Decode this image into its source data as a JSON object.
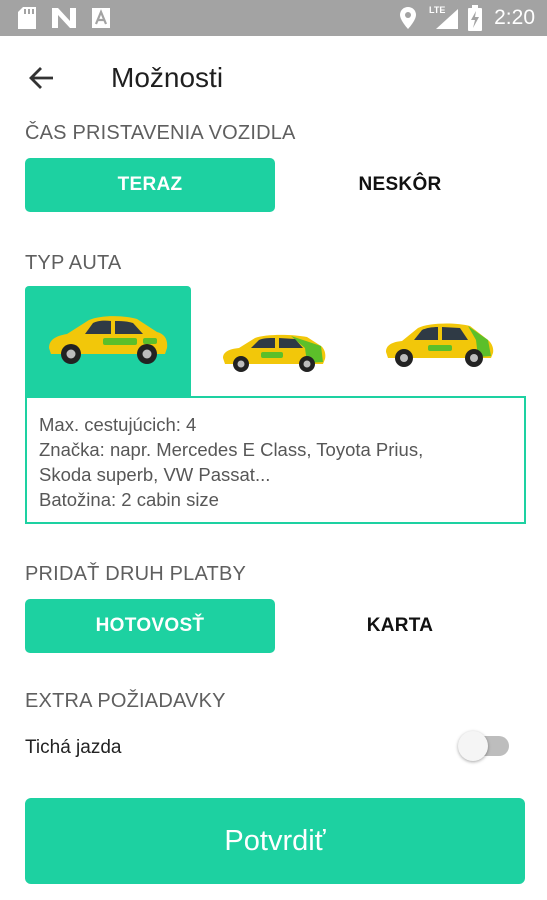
{
  "status_bar": {
    "time": "2:20",
    "network": "LTE",
    "icons": [
      "sd-card-icon",
      "n-notification-icon",
      "a-notification-icon",
      "location-icon",
      "signal-icon",
      "battery-charging-icon"
    ]
  },
  "app_bar": {
    "title": "Možnosti",
    "back_icon": "arrow-back-icon"
  },
  "pickup_time": {
    "label": "ČAS PRISTAVENIA VOZIDLA",
    "options": [
      "TERAZ",
      "NESKÔR"
    ],
    "selected": "TERAZ"
  },
  "car_type": {
    "label": "TYP AUTA",
    "cars": [
      "sedan-taxi-icon",
      "estate-taxi-icon",
      "hatchback-taxi-icon"
    ],
    "selected_index": 0,
    "info": {
      "line1": "Max. cestujúcich: 4",
      "line2": "Značka: napr. Mercedes E Class, Toyota Prius,",
      "line3": "Skoda superb, VW Passat...",
      "line4": "Batožina: 2 cabin size"
    }
  },
  "payment": {
    "label": "PRIDAŤ DRUH PLATBY",
    "options": [
      "HOTOVOSŤ",
      "KARTA"
    ],
    "selected": "HOTOVOSŤ"
  },
  "extras": {
    "label": "EXTRA POŽIADAVKY",
    "quiet_ride": {
      "label": "Tichá jazda",
      "enabled": false
    }
  },
  "confirm_label": "Potvrdiť",
  "colors": {
    "accent": "#1dd1a1",
    "status_bar": "#a3a3a3",
    "taxi_yellow": "#f2c70a",
    "taxi_green": "#5cbf2a"
  }
}
